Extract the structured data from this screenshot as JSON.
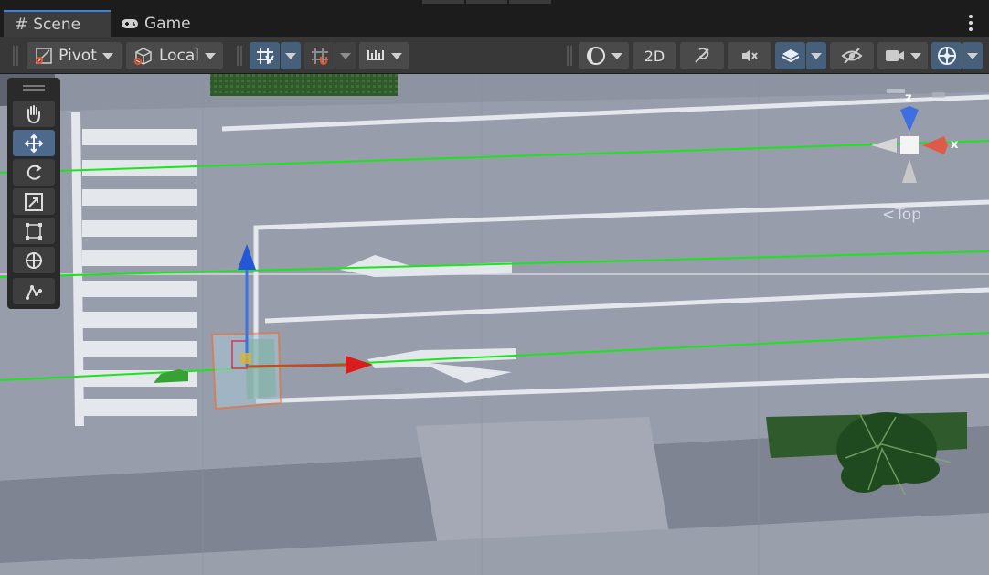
{
  "tabs": {
    "scene": {
      "label": "Scene",
      "icon": "hash-icon"
    },
    "game": {
      "label": "Game",
      "icon": "gamepad-icon"
    }
  },
  "toolbar": {
    "pivot_label": "Pivot",
    "local_label": "Local",
    "mode_2d_label": "2D"
  },
  "tools": [
    "hand-tool",
    "move-tool",
    "rotate-tool",
    "scale-tool",
    "rect-tool",
    "transform-tool",
    "custom-tool"
  ],
  "gizmo": {
    "z_label": "z",
    "x_label": "x",
    "view_label": "<Top"
  },
  "colors": {
    "accent": "#3b82d6",
    "toolbar_bg": "#383838",
    "selected_tool": "#4d6a8d",
    "road": "#9a9fac",
    "grass_line": "#00ff00"
  }
}
